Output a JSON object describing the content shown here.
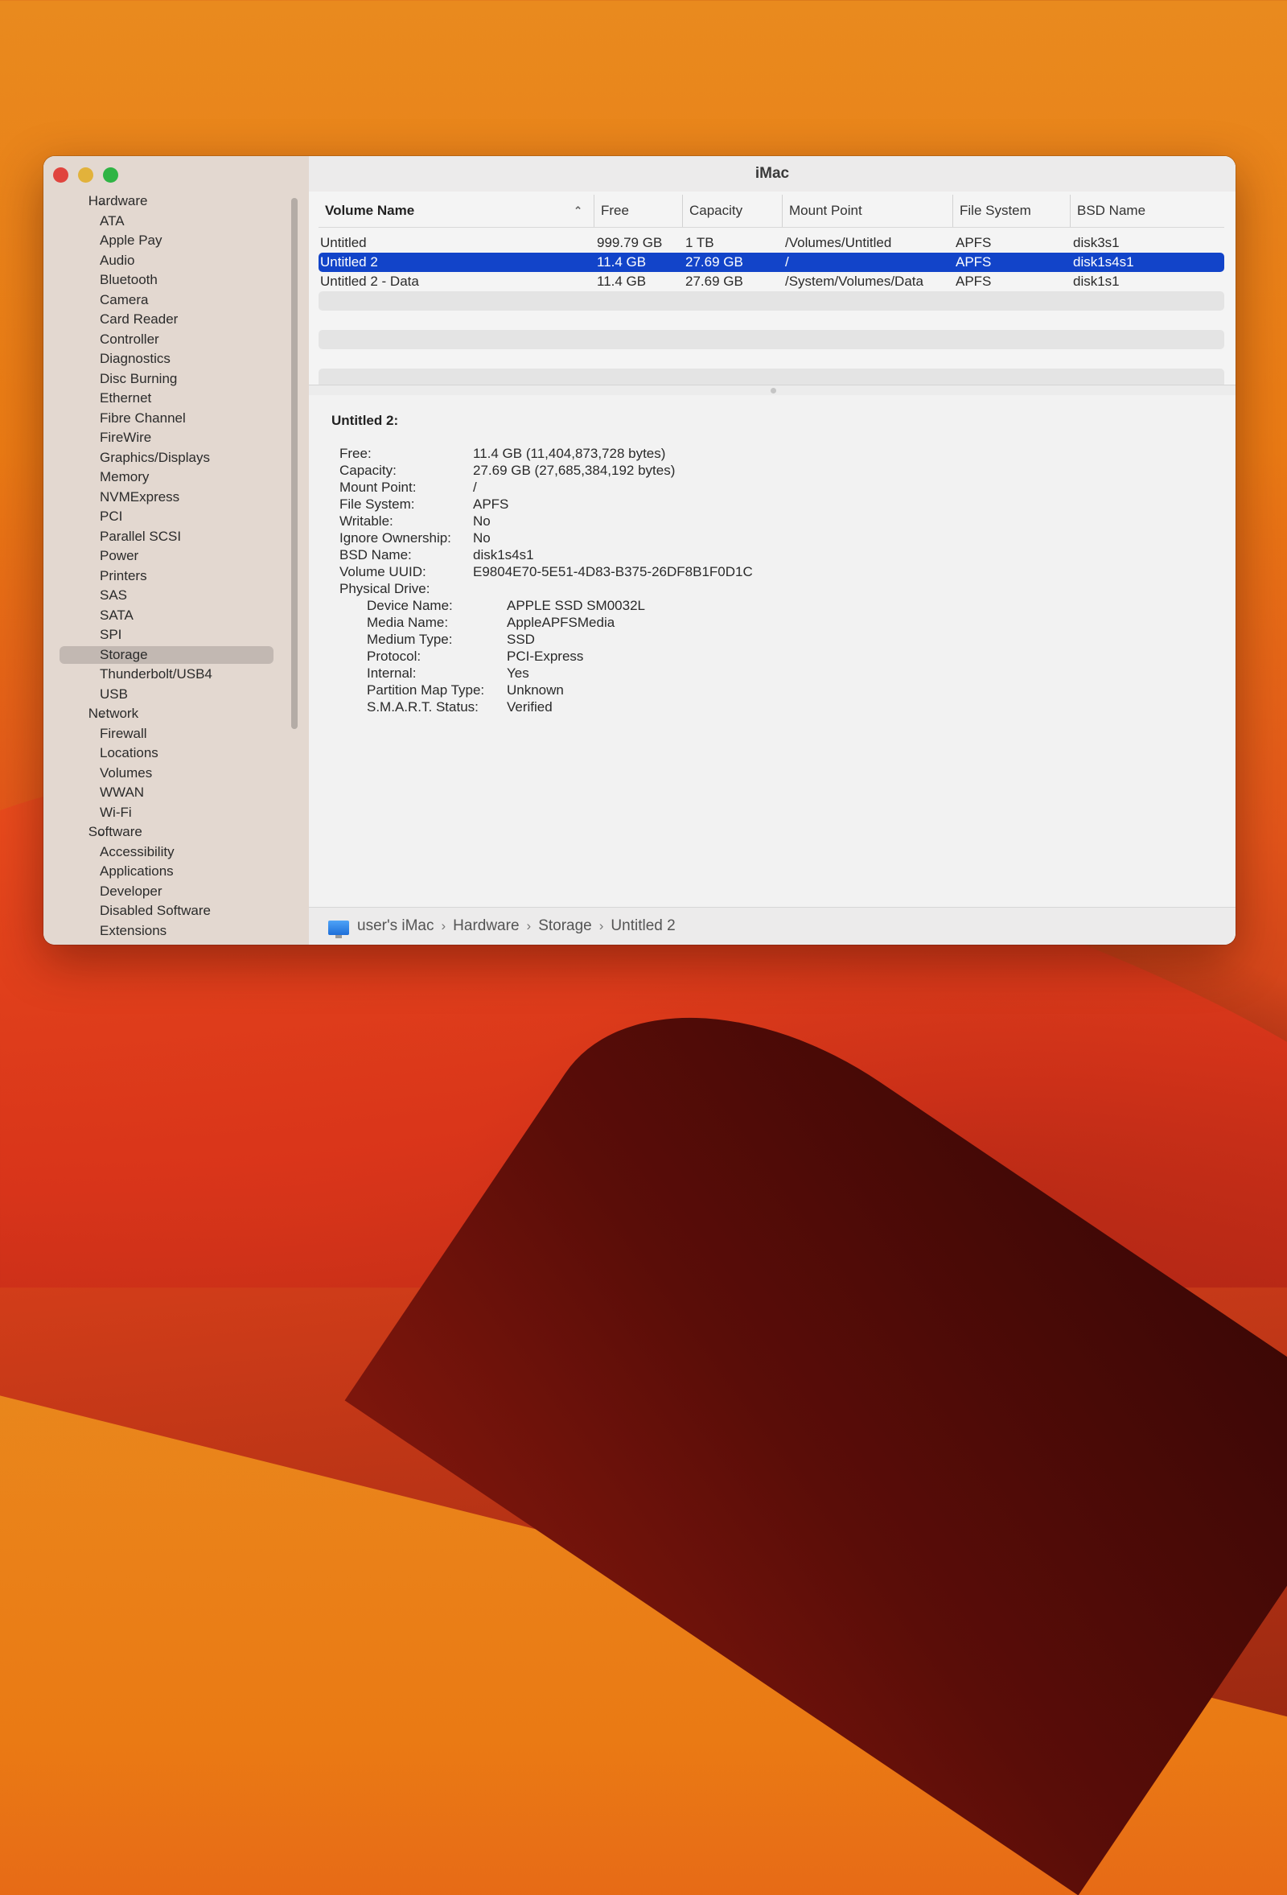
{
  "window": {
    "title": "iMac"
  },
  "sidebar": {
    "groups": [
      {
        "label": "Hardware",
        "items": [
          "ATA",
          "Apple Pay",
          "Audio",
          "Bluetooth",
          "Camera",
          "Card Reader",
          "Controller",
          "Diagnostics",
          "Disc Burning",
          "Ethernet",
          "Fibre Channel",
          "FireWire",
          "Graphics/Displays",
          "Memory",
          "NVMExpress",
          "PCI",
          "Parallel SCSI",
          "Power",
          "Printers",
          "SAS",
          "SATA",
          "SPI",
          "Storage",
          "Thunderbolt/USB4",
          "USB"
        ]
      },
      {
        "label": "Network",
        "items": [
          "Firewall",
          "Locations",
          "Volumes",
          "WWAN",
          "Wi-Fi"
        ]
      },
      {
        "label": "Software",
        "items": [
          "Accessibility",
          "Applications",
          "Developer",
          "Disabled Software",
          "Extensions"
        ]
      }
    ],
    "selected": "Storage"
  },
  "table": {
    "columns": [
      "Volume Name",
      "Free",
      "Capacity",
      "Mount Point",
      "File System",
      "BSD Name"
    ],
    "rows": [
      [
        "Untitled",
        "999.79 GB",
        "1 TB",
        "/Volumes/Untitled",
        "APFS",
        "disk3s1"
      ],
      [
        "Untitled 2",
        "11.4 GB",
        "27.69 GB",
        "/",
        "APFS",
        "disk1s4s1"
      ],
      [
        "Untitled 2 - Data",
        "11.4 GB",
        "27.69 GB",
        "/System/Volumes/Data",
        "APFS",
        "disk1s1"
      ]
    ],
    "selected_row": 1
  },
  "details": {
    "title": "Untitled 2:",
    "fields": [
      {
        "key": "Free:",
        "value": "11.4 GB (11,404,873,728 bytes)"
      },
      {
        "key": "Capacity:",
        "value": "27.69 GB (27,685,384,192 bytes)"
      },
      {
        "key": "Mount Point:",
        "value": "/"
      },
      {
        "key": "File System:",
        "value": "APFS"
      },
      {
        "key": "Writable:",
        "value": "No"
      },
      {
        "key": "Ignore Ownership:",
        "value": "No"
      },
      {
        "key": "BSD Name:",
        "value": "disk1s4s1"
      },
      {
        "key": "Volume UUID:",
        "value": "E9804E70-5E51-4D83-B375-26DF8B1F0D1C"
      },
      {
        "key": "Physical Drive:",
        "value": ""
      }
    ],
    "physical_drive": [
      {
        "key": "Device Name:",
        "value": "APPLE SSD SM0032L"
      },
      {
        "key": "Media Name:",
        "value": "AppleAPFSMedia"
      },
      {
        "key": "Medium Type:",
        "value": "SSD"
      },
      {
        "key": "Protocol:",
        "value": "PCI-Express"
      },
      {
        "key": "Internal:",
        "value": "Yes"
      },
      {
        "key": "Partition Map Type:",
        "value": "Unknown"
      },
      {
        "key": "S.M.A.R.T. Status:",
        "value": "Verified"
      }
    ]
  },
  "pathbar": {
    "crumbs": [
      "user's iMac",
      "Hardware",
      "Storage",
      "Untitled 2"
    ]
  },
  "colors": {
    "selection": "#1244c9",
    "sidebar_bg": "#e3d8d0"
  }
}
